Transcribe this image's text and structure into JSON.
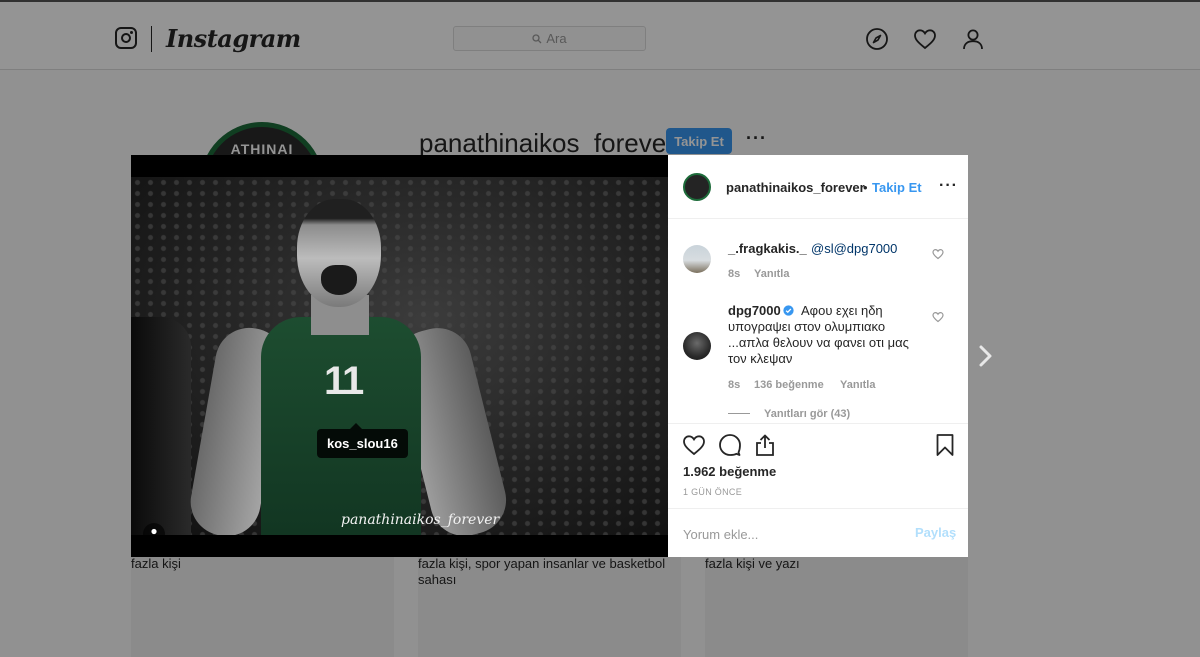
{
  "topbar": {
    "brand": "Instagram",
    "search_placeholder": "Ara",
    "icons": [
      "instagram-camera-icon",
      "compass-icon",
      "heart-icon",
      "person-icon"
    ]
  },
  "profile": {
    "avatar_text": "ATHINAI",
    "username": "panathinaikos_forever",
    "follow_label": "Takip Et",
    "more_label": "···"
  },
  "grid": {
    "captions": [
      "fazla kişi",
      "fazla kişi, spor yapan insanlar ve basketbol sahası",
      "fazla kişi ve yazı"
    ]
  },
  "modal": {
    "photo": {
      "jersey_number": "11",
      "tag": "kos_slou16",
      "watermark": "panathinaikos_forever"
    },
    "header": {
      "username": "panathinaikos_forever",
      "separator": "•",
      "follow_label": "Takip Et",
      "more_label": "···"
    },
    "comments": [
      {
        "user": "_.fragkakis._",
        "mention": "@sl@dpg7000",
        "time": "8s",
        "reply_label": "Yanıtla"
      },
      {
        "user": "dpg7000",
        "verified": true,
        "text_lines": [
          "Αφου εχει ηδη",
          "υπογραψει στον ολυμπιακο",
          "...απλα θελουν να φανει οτι μας",
          "τον κλεψαν"
        ],
        "time": "8s",
        "likes": "136 beğenme",
        "reply_label": "Yanıtla",
        "view_replies": "Yanıtları gör (43)"
      }
    ],
    "likes_count": "1.962 beğenme",
    "posted": "1 GÜN ÖNCE",
    "comment_placeholder": "Yorum ekle...",
    "share_label": "Paylaş"
  },
  "colors": {
    "accent": "#3897f0",
    "share_disabled": "#b2dffc",
    "muted": "#999999",
    "club_green": "#1d6b3a"
  }
}
